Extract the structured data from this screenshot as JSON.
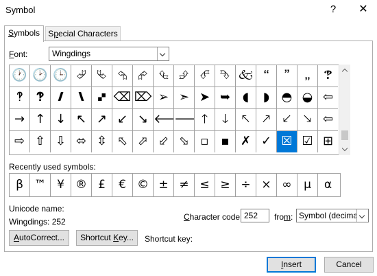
{
  "window": {
    "title": "Symbol",
    "help_glyph": "?",
    "close_glyph": "✕"
  },
  "tabs": [
    {
      "label_u": "S",
      "label_rest": "ymbols",
      "active": true
    },
    {
      "label_pre": "S",
      "label_u": "p",
      "label_rest": "ecial Characters",
      "active": false
    }
  ],
  "font": {
    "label_u": "F",
    "label_rest": "ont:",
    "value": "Wingdings"
  },
  "symbol_grid": {
    "columns": 16,
    "selected_index": 61,
    "rows": [
      [
        "🕐",
        "🕑",
        "🕒",
        "⮰",
        "⮱",
        "⮲",
        "⮳",
        "⮴",
        "⮵",
        "⮶",
        "⮷",
        "🙵",
        "🙶",
        "🙷",
        "🙸",
        "🙹"
      ],
      [
        "🙺",
        "🙻",
        "🙼",
        "🙽",
        "🙾",
        "⌫",
        "⌦",
        "➢",
        "➣",
        "➤",
        "➥",
        "◖",
        "◗",
        "◓",
        "◒",
        "⇦"
      ],
      [
        "→",
        "↑",
        "↓",
        "↖",
        "↗",
        "↙",
        "↘",
        "🡐",
        "🡒",
        "🡑",
        "🡓",
        "🡔",
        "🡕",
        "🡗",
        "🡖",
        "⇦"
      ],
      [
        "⇨",
        "⇧",
        "⇩",
        "⬄",
        "⇳",
        "⬁",
        "⬀",
        "⬃",
        "⬂",
        "▫",
        "▪",
        "✗",
        "✓",
        "☒",
        "☑",
        "⊞"
      ]
    ]
  },
  "recent": {
    "label": "Recently used symbols:",
    "symbols": [
      "β",
      "™",
      "¥",
      "®",
      "£",
      "€",
      "©",
      "±",
      "≠",
      "≤",
      "≥",
      "÷",
      "×",
      "∞",
      "µ",
      "α"
    ]
  },
  "unicode": {
    "name_label": "Unicode name:",
    "name_value": "Wingdings: 252"
  },
  "character_code": {
    "label_u": "C",
    "label_rest": "haracter code:",
    "value": "252"
  },
  "from": {
    "label_pre": "fro",
    "label_u": "m",
    "label_rest": ":",
    "value": "Symbol (decimal)"
  },
  "buttons": {
    "autocorrect_u": "A",
    "autocorrect_rest": "utoCorrect...",
    "shortcut_pre": "Shortcut ",
    "shortcut_u": "K",
    "shortcut_rest": "ey...",
    "insert_u": "I",
    "insert_rest": "nsert",
    "cancel": "Cancel"
  },
  "shortcut_key_label": "Shortcut key:"
}
